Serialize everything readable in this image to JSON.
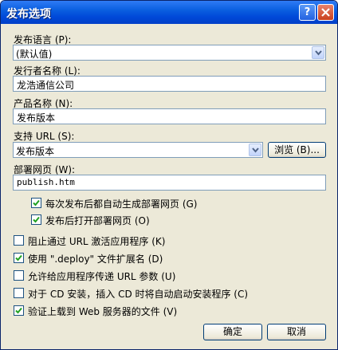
{
  "window": {
    "title": "发布选项"
  },
  "fields": {
    "language": {
      "label": "发布语言 (P):",
      "value": "(默认值)"
    },
    "publisher": {
      "label": "发行者名称 (L):",
      "value": "龙浩通信公司"
    },
    "product": {
      "label": "产品名称 (N):",
      "value": "发布版本"
    },
    "support_url": {
      "label": "支持 URL (S):",
      "value": "发布版本",
      "browse_label": "浏览 (B)..."
    },
    "deploy_page": {
      "label": "部署网页 (W):",
      "value": "publish.htm"
    }
  },
  "checkboxes": [
    {
      "label": "每次发布后都自动生成部署网页 (G)",
      "checked": true
    },
    {
      "label": "发布后打开部署网页 (O)",
      "checked": true
    },
    {
      "label": "阻止通过 URL 激活应用程序 (K)",
      "checked": false
    },
    {
      "label": "使用 \".deploy\" 文件扩展名 (D)",
      "checked": true
    },
    {
      "label": "允许给应用程序传递 URL 参数 (U)",
      "checked": false
    },
    {
      "label": "对于 CD 安装，插入 CD 时将自动启动安装程序 (C)",
      "checked": false
    },
    {
      "label": "验证上载到 Web 服务器的文件 (V)",
      "checked": true
    }
  ],
  "buttons": {
    "ok": "确定",
    "cancel": "取消"
  }
}
